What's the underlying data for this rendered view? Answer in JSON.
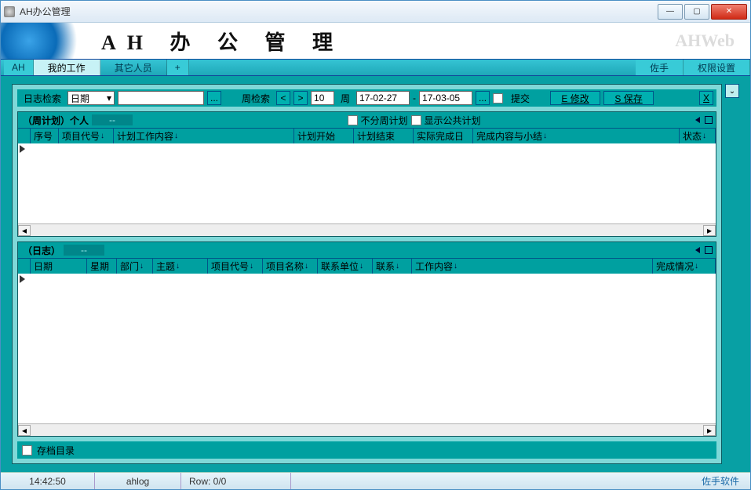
{
  "window": {
    "title": "AH办公管理"
  },
  "banner": {
    "title": "AH 办 公 管 理",
    "brand": "AHWeb"
  },
  "tabs": {
    "ah": "AH",
    "mywork": "我的工作",
    "others": "其它人员",
    "plus": "+",
    "zuoshou": "佐手",
    "perm": "权限设置"
  },
  "toolbar": {
    "search_label": "日志检索",
    "date_option": "日期",
    "dots": "...",
    "week_label": "周检索",
    "lt": "<",
    "gt": ">",
    "week_num": "10",
    "week_word": "周",
    "date_from": "17-02-27",
    "dash": "-",
    "date_to": "17-03-05",
    "dots2": "...",
    "submit": "提交",
    "edit": "E 修改",
    "save": "S 保存",
    "x": "X"
  },
  "panel1": {
    "title": "（周计划）个人",
    "dash": "--",
    "no_weekly": "不分周计划",
    "show_public": "显示公共计划",
    "cols": [
      "序号",
      "项目代号",
      "计划工作内容",
      "计划开始",
      "计划结束",
      "实际完成日",
      "完成内容与小结",
      "状态"
    ]
  },
  "panel2": {
    "title": "（日志）",
    "dash": "--",
    "cols": [
      "日期",
      "星期",
      "部门",
      "主题",
      "项目代号",
      "项目名称",
      "联系单位",
      "联系",
      "工作内容",
      "完成情况"
    ]
  },
  "archive": {
    "label": "存档目录"
  },
  "status": {
    "time": "14:42:50",
    "name": "ahlog",
    "row": "Row: 0/0",
    "brand": "佐手软件"
  }
}
